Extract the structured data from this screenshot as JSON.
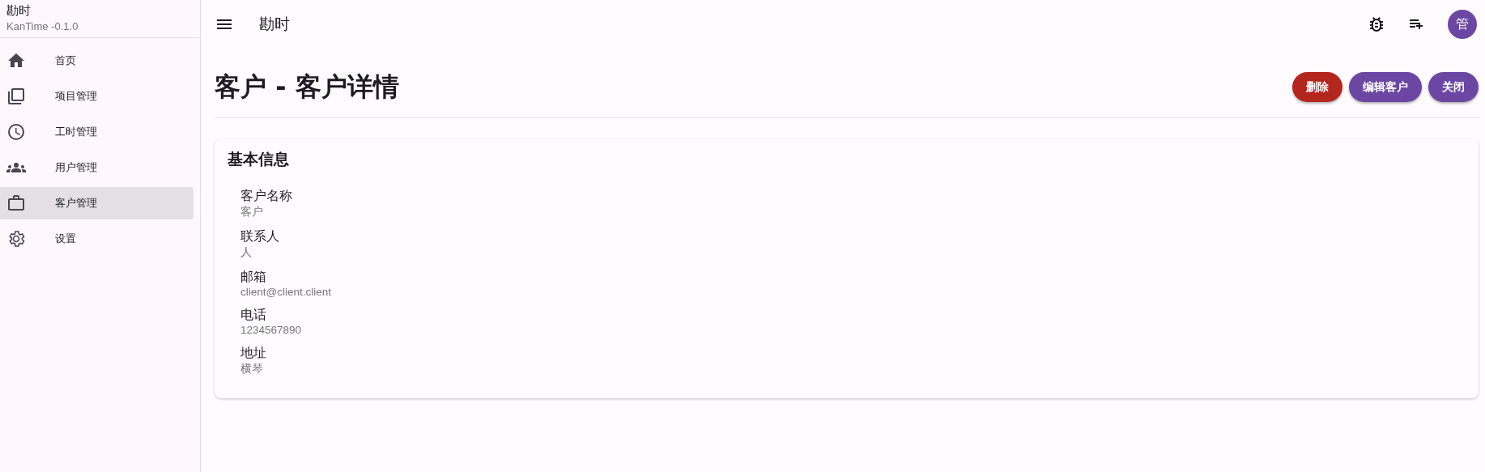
{
  "app": {
    "name": "勘时",
    "version": "KanTime -0.1.0"
  },
  "sidebar": {
    "items": [
      {
        "label": "首页",
        "selected": false
      },
      {
        "label": "项目管理",
        "selected": false
      },
      {
        "label": "工时管理",
        "selected": false
      },
      {
        "label": "用户管理",
        "selected": false
      },
      {
        "label": "客户管理",
        "selected": true
      },
      {
        "label": "设置",
        "selected": false
      }
    ]
  },
  "top_bar": {
    "title": "勘时",
    "avatar": "管"
  },
  "page": {
    "title": "客户 - 客户详情",
    "buttons": [
      {
        "kind": "danger",
        "label": "删除"
      },
      {
        "kind": "primary",
        "label": "编辑客户"
      },
      {
        "kind": "primary",
        "label": "关闭"
      }
    ]
  },
  "card": {
    "title": "基本信息",
    "fields": [
      {
        "label": "客户名称",
        "value": "客户"
      },
      {
        "label": "联系人",
        "value": "人"
      },
      {
        "label": "邮箱",
        "value": "client@client.client"
      },
      {
        "label": "电话",
        "value": "1234567890"
      },
      {
        "label": "地址",
        "value": "横琴"
      }
    ]
  }
}
